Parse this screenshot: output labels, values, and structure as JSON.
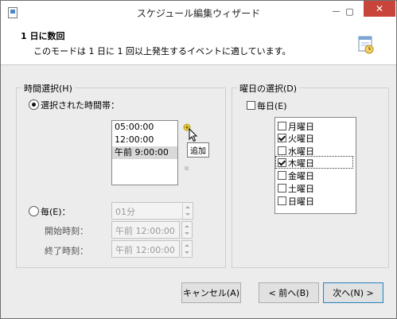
{
  "window": {
    "title": "スケジュール編集ウィザード",
    "close_glyph": "✕",
    "min_glyph": "—",
    "max_glyph": "▢"
  },
  "header": {
    "title": "1 日に数回",
    "description": "このモードは 1 日に 1 回以上発生するイベントに適しています。"
  },
  "time_group": {
    "legend": "時間選択(H)",
    "selected_times_label": "選択された時間帯：",
    "times": [
      "05:00:00",
      "12:00:00",
      "午前 9:00:00"
    ],
    "add_tooltip": "追加",
    "every_label": "毎(E)：",
    "interval_value": "01分",
    "start_label": "開始時刻：",
    "start_value": "午前 12:00:00",
    "end_label": "終了時刻：",
    "end_value": "午前 12:00:00"
  },
  "day_group": {
    "legend": "曜日の選択(D)",
    "every_day_label": "毎日(E)",
    "days": [
      {
        "label": "月曜日",
        "checked": false
      },
      {
        "label": "火曜日",
        "checked": true
      },
      {
        "label": "水曜日",
        "checked": false
      },
      {
        "label": "木曜日",
        "checked": true
      },
      {
        "label": "金曜日",
        "checked": false
      },
      {
        "label": "土曜日",
        "checked": false
      },
      {
        "label": "日曜日",
        "checked": false
      }
    ]
  },
  "buttons": {
    "cancel": "キャンセル(A)",
    "back": "< 前へ(B)",
    "next": "次へ(N) >"
  },
  "colors": {
    "close_button": "#c7453b",
    "accent": "#3c7fb1",
    "add_icon": "#d4b200"
  }
}
